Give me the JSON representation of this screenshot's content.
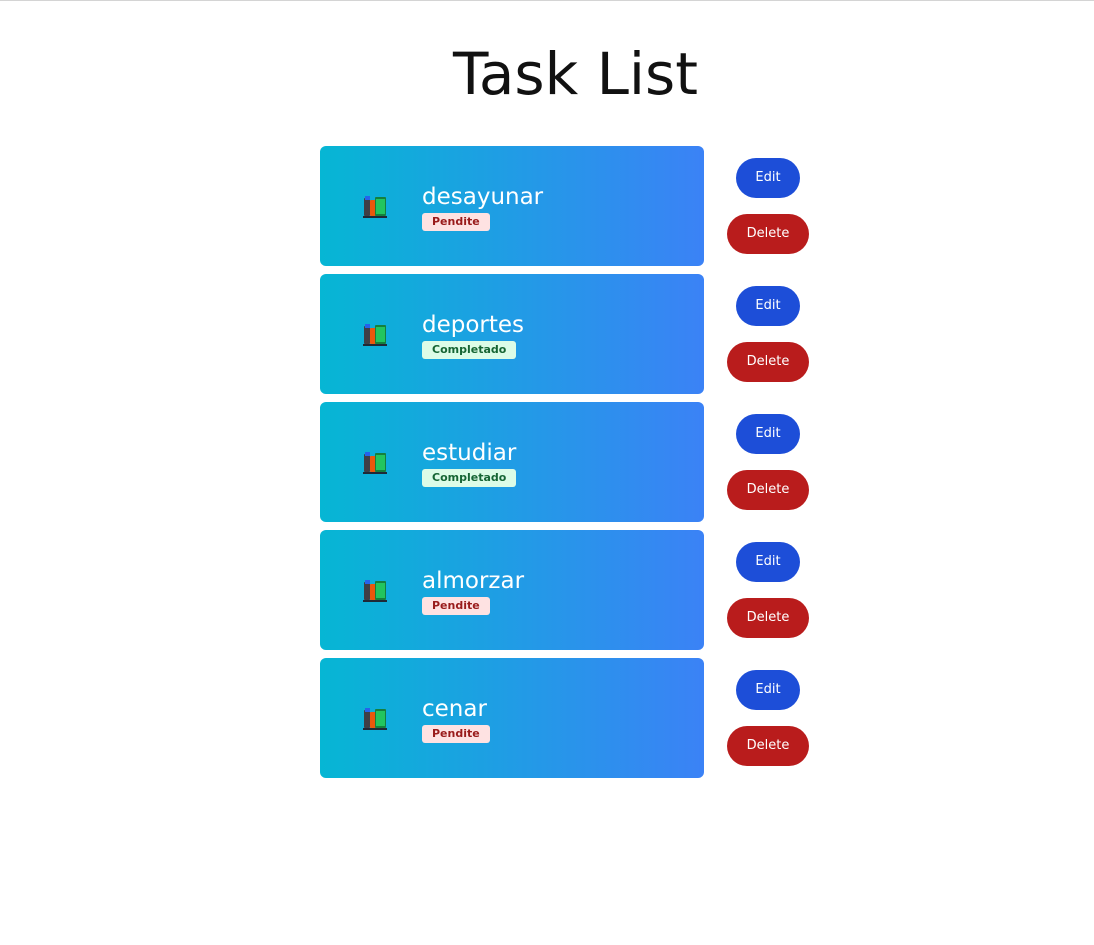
{
  "page": {
    "title": "Task List"
  },
  "colors": {
    "card_gradient_start": "#06b6d4",
    "card_gradient_end": "#3b82f6",
    "edit_button": "#1d4ed8",
    "delete_button": "#b91c1c",
    "pending_badge_bg": "#fee2e2",
    "pending_badge_text": "#991b1b",
    "completed_badge_bg": "#dcfce7",
    "completed_badge_text": "#166534"
  },
  "tasks": [
    {
      "icon": "books-icon",
      "name": "desayunar",
      "status": "Pendite",
      "completed": false,
      "edit_label": "Edit",
      "delete_label": "Delete"
    },
    {
      "icon": "books-icon",
      "name": "deportes",
      "status": "Completado",
      "completed": true,
      "edit_label": "Edit",
      "delete_label": "Delete"
    },
    {
      "icon": "books-icon",
      "name": "estudiar",
      "status": "Completado",
      "completed": true,
      "edit_label": "Edit",
      "delete_label": "Delete"
    },
    {
      "icon": "books-icon",
      "name": "almorzar",
      "status": "Pendite",
      "completed": false,
      "edit_label": "Edit",
      "delete_label": "Delete"
    },
    {
      "icon": "books-icon",
      "name": "cenar",
      "status": "Pendite",
      "completed": false,
      "edit_label": "Edit",
      "delete_label": "Delete"
    }
  ]
}
